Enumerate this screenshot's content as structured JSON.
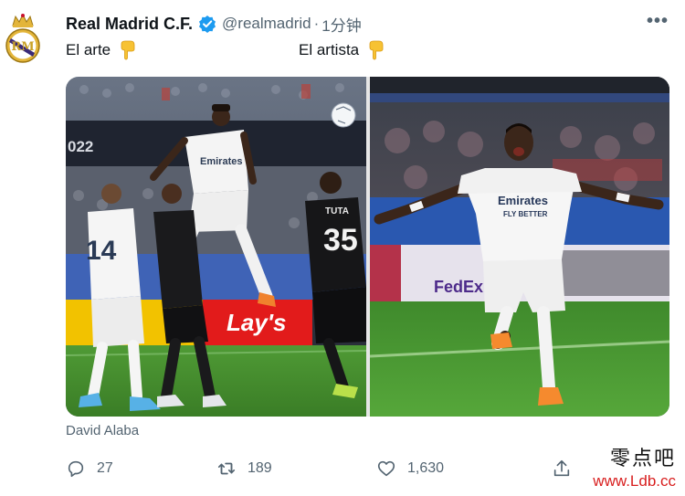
{
  "tweet": {
    "author": {
      "display_name": "Real Madrid C.F.",
      "handle": "@realmadrid",
      "verified_icon": "verified-badge-icon",
      "avatar_icon": "real-madrid-crest-icon"
    },
    "separator": "·",
    "timestamp": "1分钟",
    "more_icon": "more-options-icon",
    "more_label": "•••",
    "captions": {
      "left": "El arte",
      "right": "El artista",
      "emoji_icon": "pointing-down-emoji-icon"
    },
    "media": {
      "left_photo": {
        "jersey_number_left": "14",
        "jersey_number_right": "35",
        "jersey_name_right": "TUTA",
        "stand_board_text": "022",
        "sponsor_text": "Emirates"
      },
      "right_photo": {
        "sponsor_text": "Emirates",
        "ad_board_text": "FedEx"
      }
    },
    "media_caption": "David Alaba",
    "actions": {
      "reply_count": "27",
      "retweet_count": "189",
      "like_count": "1,630"
    }
  },
  "watermark": {
    "chinese": "零点吧",
    "url": "www.Ldb.cc"
  },
  "colors": {
    "brand_blue": "#1d9bf0",
    "secondary_text": "#536471",
    "watermark_red": "#d81e1e",
    "pitch_green": "#3f8a2c"
  }
}
